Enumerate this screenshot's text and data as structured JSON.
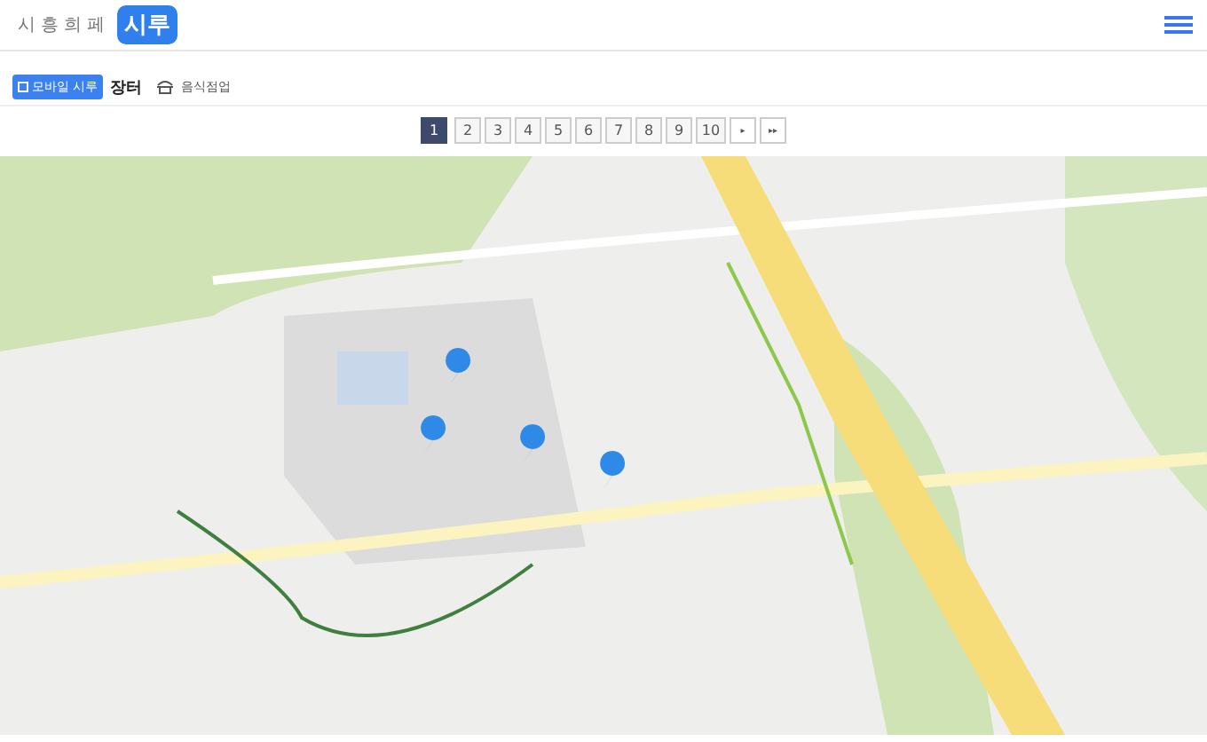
{
  "header": {
    "site_name": "시흥희페",
    "logo_text": "시루"
  },
  "breadcrumb": {
    "badge": "모바일 시루",
    "title": "장터",
    "category": "음식점업"
  },
  "pagination": {
    "pages": [
      {
        "label": "1",
        "selected": true
      },
      {
        "label": "2",
        "selected": false
      },
      {
        "label": "3",
        "selected": false
      },
      {
        "label": "4",
        "selected": false
      },
      {
        "label": "5",
        "selected": false
      },
      {
        "label": "6",
        "selected": false
      },
      {
        "label": "7",
        "selected": false
      },
      {
        "label": "8",
        "selected": false
      },
      {
        "label": "9",
        "selected": false
      },
      {
        "label": "10",
        "selected": false
      }
    ],
    "next": "▸",
    "last": "▸▸"
  }
}
